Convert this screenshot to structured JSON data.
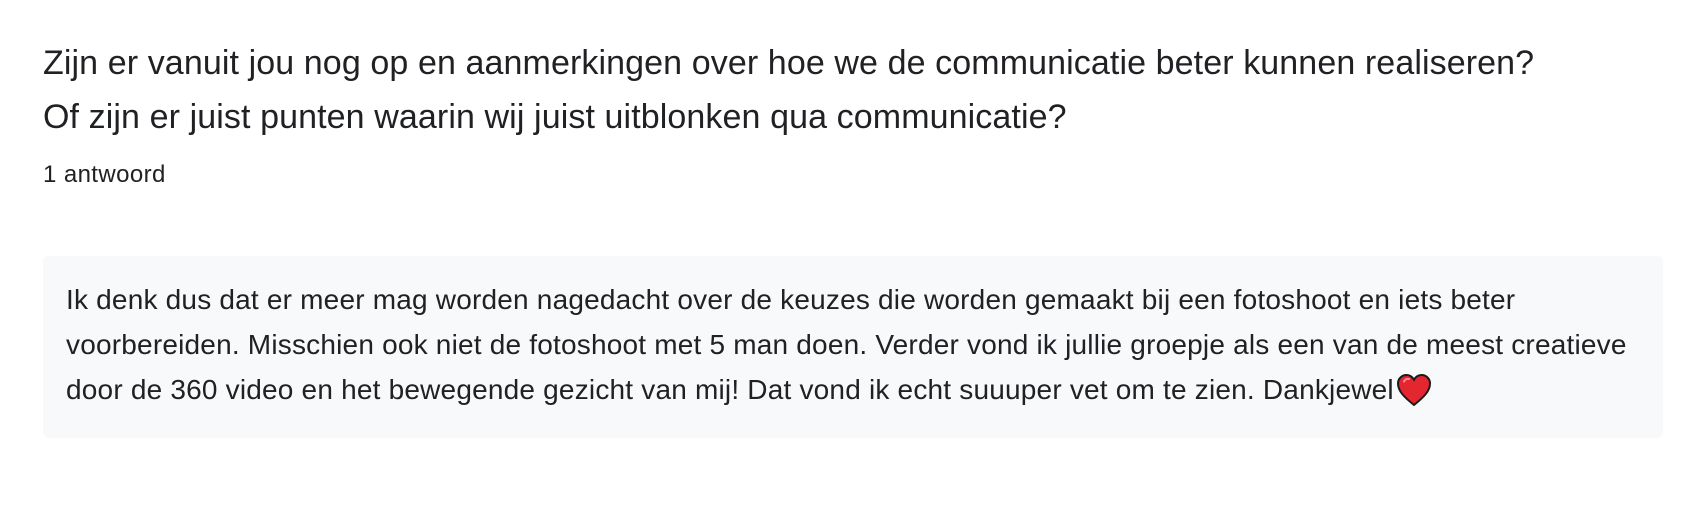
{
  "question": {
    "title_line_1": "Zijn er vanuit jou nog op en aanmerkingen over hoe we de communicatie beter kunnen realiseren?",
    "title_line_2": "Of zijn er juist punten waarin wij juist uitblonken qua communicatie?",
    "answer_count": "1 antwoord"
  },
  "responses": [
    {
      "text": "Ik denk dus dat er meer mag worden nagedacht over de keuzes die worden gemaakt bij een fotoshoot en iets beter voorbereiden. Misschien ook niet de fotoshoot met 5 man doen. Verder vond ik jullie groepje als een van de meest creatieve door de 360 video en het bewegende gezicht van mij! Dat vond ik echt suuuper vet om te zien. Dankjewel",
      "emoji": "heart-icon"
    }
  ],
  "colors": {
    "text": "#202124",
    "response_background": "#f8f9fa",
    "heart": "#e3262f"
  }
}
